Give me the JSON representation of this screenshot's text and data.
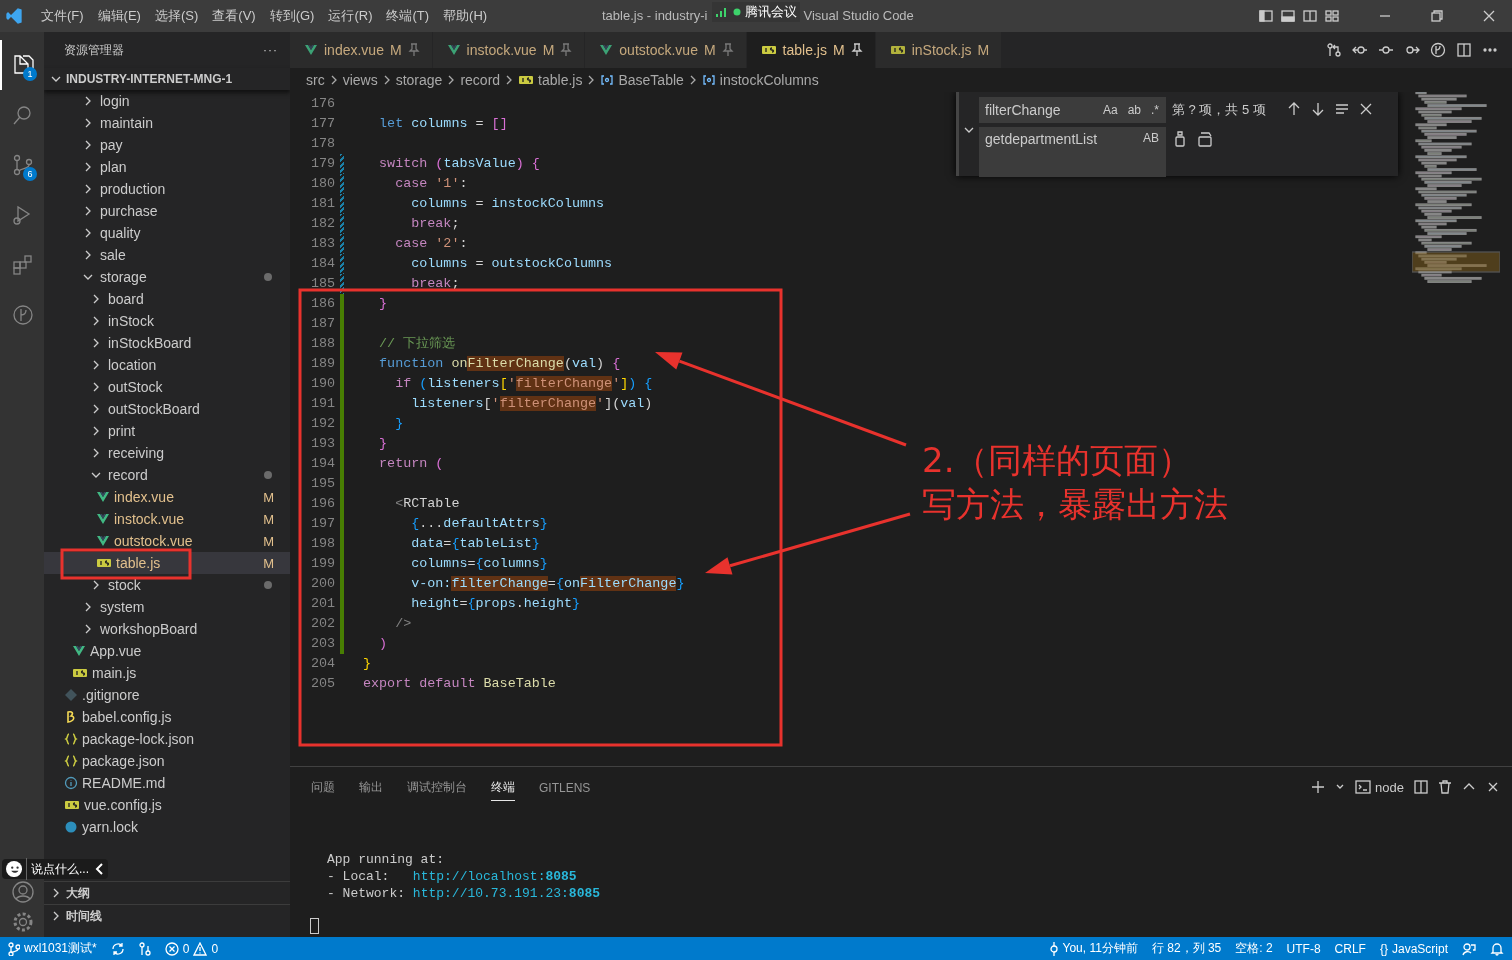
{
  "menu": [
    "文件(F)",
    "编辑(E)",
    "选择(S)",
    "查看(V)",
    "转到(G)",
    "运行(R)",
    "终端(T)",
    "帮助(H)"
  ],
  "title": {
    "file_part": "table.js - industry-i",
    "app_part": "Visual Studio Code"
  },
  "meeting": {
    "label": "腾讯会议"
  },
  "activity_bar": {
    "items": [
      {
        "kind": "files",
        "selected": true,
        "badge": "1"
      },
      {
        "kind": "search",
        "selected": false
      },
      {
        "kind": "scm",
        "selected": false,
        "badge": "6"
      },
      {
        "kind": "debug",
        "selected": false
      },
      {
        "kind": "extensions",
        "selected": false
      },
      {
        "kind": "gitlens",
        "selected": false
      }
    ]
  },
  "sidebar": {
    "title": "资源管理器",
    "more": "···",
    "root": "INDUSTRY-INTERNET-MNG-1",
    "tree": [
      {
        "children": [
          {
            "children": [
              {
                "label": "login",
                "kind": "folder",
                "expanded": false,
                "selected": false
              },
              {
                "label": "maintain",
                "kind": "folder",
                "expanded": false,
                "selected": false
              },
              {
                "label": "pay",
                "kind": "folder",
                "expanded": false,
                "selected": false
              },
              {
                "label": "plan",
                "kind": "folder",
                "expanded": false,
                "selected": false
              },
              {
                "label": "production",
                "kind": "folder",
                "expanded": false,
                "selected": false
              },
              {
                "label": "purchase",
                "kind": "folder",
                "expanded": false,
                "selected": false
              },
              {
                "label": "quality",
                "kind": "folder",
                "expanded": false,
                "selected": false
              },
              {
                "label": "sale",
                "kind": "folder",
                "expanded": false,
                "selected": false
              },
              {
                "label": "storage",
                "kind": "folder",
                "expanded": true,
                "dot": true,
                "selected": false,
                "children": [
                  {
                    "label": "board",
                    "kind": "folder",
                    "expanded": false,
                    "selected": false
                  },
                  {
                    "label": "inStock",
                    "kind": "folder",
                    "expanded": false,
                    "selected": false
                  },
                  {
                    "label": "inStockBoard",
                    "kind": "folder",
                    "expanded": false,
                    "selected": false
                  },
                  {
                    "label": "location",
                    "kind": "folder",
                    "expanded": false,
                    "selected": false
                  },
                  {
                    "label": "outStock",
                    "kind": "folder",
                    "expanded": false,
                    "selected": false
                  },
                  {
                    "label": "outStockBoard",
                    "kind": "folder",
                    "expanded": false,
                    "selected": false
                  },
                  {
                    "label": "print",
                    "kind": "folder",
                    "expanded": false,
                    "selected": false
                  },
                  {
                    "label": "receiving",
                    "kind": "folder",
                    "expanded": false,
                    "selected": false
                  },
                  {
                    "label": "record",
                    "kind": "folder",
                    "expanded": true,
                    "dot": true,
                    "selected": false,
                    "children": [
                      {
                        "label": "index.vue",
                        "kind": "vue",
                        "badge": "M",
                        "selected": false
                      },
                      {
                        "label": "instock.vue",
                        "kind": "vue",
                        "badge": "M",
                        "selected": false
                      },
                      {
                        "label": "outstock.vue",
                        "kind": "vue",
                        "badge": "M",
                        "selected": false
                      },
                      {
                        "label": "table.js",
                        "kind": "js",
                        "badge": "M",
                        "selected": true
                      }
                    ]
                  },
                  {
                    "label": "stock",
                    "kind": "folder",
                    "expanded": false,
                    "dot": true,
                    "selected": false
                  }
                ]
              },
              {
                "label": "system",
                "kind": "folder",
                "expanded": false,
                "selected": false
              },
              {
                "label": "workshopBoard",
                "kind": "folder",
                "expanded": false,
                "selected": false
              }
            ]
          },
          {
            "label": "App.vue",
            "kind": "vue",
            "selected": false
          },
          {
            "label": "main.js",
            "kind": "js",
            "selected": false
          }
        ]
      },
      {
        "label": ".gitignore",
        "kind": "git",
        "selected": false
      },
      {
        "label": "babel.config.js",
        "kind": "babel",
        "selected": false
      },
      {
        "label": "package-lock.json",
        "kind": "json",
        "selected": false
      },
      {
        "label": "package.json",
        "kind": "json",
        "selected": false
      },
      {
        "label": "README.md",
        "kind": "info",
        "selected": false
      },
      {
        "label": "vue.config.js",
        "kind": "js",
        "selected": false
      },
      {
        "label": "yarn.lock",
        "kind": "yarn",
        "selected": false
      }
    ],
    "sections": [
      {
        "label": "大纲",
        "expanded": false
      },
      {
        "label": "时间线",
        "expanded": false
      }
    ]
  },
  "chat_widget": {
    "placeholder": "说点什么..."
  },
  "tabs": [
    {
      "label": "index.vue",
      "kind": "vue",
      "badge": "M",
      "pinned": true,
      "selected": false
    },
    {
      "label": "instock.vue",
      "kind": "vue",
      "badge": "M",
      "pinned": true,
      "selected": false
    },
    {
      "label": "outstock.vue",
      "kind": "vue",
      "badge": "M",
      "pinned": true,
      "selected": false
    },
    {
      "label": "table.js",
      "kind": "js",
      "badge": "M",
      "pinned": true,
      "selected": true
    },
    {
      "label": "inStock.js",
      "kind": "js",
      "badge": "M",
      "pinned": false,
      "selected": false
    }
  ],
  "breadcrumbs": [
    {
      "label": "src",
      "kind": "folder"
    },
    {
      "label": "views",
      "kind": "folder"
    },
    {
      "label": "storage",
      "kind": "folder"
    },
    {
      "label": "record",
      "kind": "folder"
    },
    {
      "label": "table.js",
      "kind": "js"
    },
    {
      "label": "BaseTable",
      "kind": "symbol"
    },
    {
      "label": "instockColumns",
      "kind": "symbol"
    }
  ],
  "find": {
    "value": "filterChange",
    "options": [
      "Aa",
      "ab",
      ".*"
    ],
    "result": "第 ? 项，共 5 项",
    "replace_value": "getdepartmentList",
    "preserve_case": "AB",
    "expanded": true
  },
  "code": {
    "lines": [
      {
        "no": "176",
        "kind": "unchanged"
      },
      {
        "no": "177",
        "kind": "unchanged",
        "segments": [
          {
            "text": "  let",
            "kind": "kw"
          },
          {
            "text": " columns",
            "kind": "var"
          },
          {
            "text": " = "
          },
          {
            "text": "[]",
            "kind": "b2"
          }
        ]
      },
      {
        "no": "178",
        "kind": "unchanged"
      },
      {
        "no": "179",
        "kind": "modified",
        "segments": [
          {
            "text": "  switch",
            "kind": "ctl"
          },
          {
            "text": " (",
            "kind": "b2"
          },
          {
            "text": "tabsValue",
            "kind": "var"
          },
          {
            "text": ")",
            "kind": "b2"
          },
          {
            "text": " {",
            "kind": "b2"
          }
        ]
      },
      {
        "no": "180",
        "kind": "modified",
        "segments": [
          {
            "text": "    case",
            "kind": "ctl"
          },
          {
            "text": " '1'",
            "kind": "str"
          },
          {
            "text": ":"
          }
        ]
      },
      {
        "no": "181",
        "kind": "modified",
        "segments": [
          {
            "text": "      columns",
            "kind": "var"
          },
          {
            "text": " = "
          },
          {
            "text": "instockColumns",
            "kind": "var"
          }
        ]
      },
      {
        "no": "182",
        "kind": "modified",
        "segments": [
          {
            "text": "      break",
            "kind": "ctl"
          },
          {
            "text": ";"
          }
        ]
      },
      {
        "no": "183",
        "kind": "modified",
        "segments": [
          {
            "text": "    case",
            "kind": "ctl"
          },
          {
            "text": " '2'",
            "kind": "str"
          },
          {
            "text": ":"
          }
        ]
      },
      {
        "no": "184",
        "kind": "modified",
        "segments": [
          {
            "text": "      columns",
            "kind": "var"
          },
          {
            "text": " = "
          },
          {
            "text": "outstockColumns",
            "kind": "var"
          }
        ]
      },
      {
        "no": "185",
        "kind": "modified",
        "segments": [
          {
            "text": "      break",
            "kind": "ctl"
          },
          {
            "text": ";"
          }
        ]
      },
      {
        "no": "186",
        "kind": "added",
        "segments": [
          {
            "text": "  }",
            "kind": "b2"
          }
        ]
      },
      {
        "no": "187",
        "kind": "added"
      },
      {
        "no": "188",
        "kind": "added",
        "segments": [
          {
            "text": "  // 下拉筛选",
            "kind": "cm"
          }
        ]
      },
      {
        "no": "189",
        "kind": "added",
        "segments": [
          {
            "text": "  function",
            "kind": "kw"
          },
          {
            "text": " on",
            "kind": "fn"
          },
          {
            "text": "FilterChange",
            "kind": "fn",
            "match": true
          },
          {
            "text": "("
          },
          {
            "text": "val",
            "kind": "var"
          },
          {
            "text": ")"
          },
          {
            "text": " {",
            "kind": "b2"
          }
        ]
      },
      {
        "no": "190",
        "kind": "added",
        "segments": [
          {
            "text": "    if",
            "kind": "ctl"
          },
          {
            "text": " (",
            "kind": "b3"
          },
          {
            "text": "listeners",
            "kind": "var"
          },
          {
            "text": "[",
            "kind": "b1"
          },
          {
            "text": "'",
            "kind": "str"
          },
          {
            "text": "filterChange",
            "kind": "str",
            "match": true
          },
          {
            "text": "'",
            "kind": "str"
          },
          {
            "text": "]",
            "kind": "b1"
          },
          {
            "text": ")",
            "kind": "b3"
          },
          {
            "text": " {",
            "kind": "b3"
          }
        ]
      },
      {
        "no": "191",
        "kind": "added",
        "segments": [
          {
            "text": "      listeners",
            "kind": "var"
          },
          {
            "text": "["
          },
          {
            "text": "'",
            "kind": "str"
          },
          {
            "text": "filterChange",
            "kind": "str",
            "match": true
          },
          {
            "text": "'",
            "kind": "str"
          },
          {
            "text": "]("
          },
          {
            "text": "val",
            "kind": "var"
          },
          {
            "text": ")"
          }
        ]
      },
      {
        "no": "192",
        "kind": "added",
        "segments": [
          {
            "text": "    }",
            "kind": "b3"
          }
        ]
      },
      {
        "no": "193",
        "kind": "added",
        "segments": [
          {
            "text": "  }",
            "kind": "b2"
          }
        ]
      },
      {
        "no": "194",
        "kind": "added",
        "segments": [
          {
            "text": "  return",
            "kind": "ctl"
          },
          {
            "text": " (",
            "kind": "b2"
          }
        ]
      },
      {
        "no": "195",
        "kind": "added"
      },
      {
        "no": "196",
        "kind": "added",
        "segments": [
          {
            "text": "    <",
            "kind": "dim"
          },
          {
            "text": "RCTable"
          }
        ]
      },
      {
        "no": "197",
        "kind": "added",
        "segments": [
          {
            "text": "      {",
            "kind": "b3"
          },
          {
            "text": "..."
          },
          {
            "text": "defaultAttrs",
            "kind": "var"
          },
          {
            "text": "}",
            "kind": "b3"
          }
        ]
      },
      {
        "no": "198",
        "kind": "added",
        "segments": [
          {
            "text": "      data",
            "kind": "var"
          },
          {
            "text": "="
          },
          {
            "text": "{",
            "kind": "b3"
          },
          {
            "text": "tableList",
            "kind": "var"
          },
          {
            "text": "}",
            "kind": "b3"
          }
        ]
      },
      {
        "no": "199",
        "kind": "added",
        "segments": [
          {
            "text": "      columns",
            "kind": "var"
          },
          {
            "text": "="
          },
          {
            "text": "{",
            "kind": "b3"
          },
          {
            "text": "columns",
            "kind": "var"
          },
          {
            "text": "}",
            "kind": "b3"
          }
        ]
      },
      {
        "no": "200",
        "kind": "added",
        "segments": [
          {
            "text": "      v-on:",
            "kind": "var"
          },
          {
            "text": "filterChange",
            "kind": "var",
            "match": true
          },
          {
            "text": "="
          },
          {
            "text": "{",
            "kind": "b3"
          },
          {
            "text": "on",
            "kind": "var"
          },
          {
            "text": "FilterChange",
            "kind": "var",
            "match": true
          },
          {
            "text": "}",
            "kind": "b3"
          }
        ]
      },
      {
        "no": "201",
        "kind": "added",
        "segments": [
          {
            "text": "      height",
            "kind": "var"
          },
          {
            "text": "="
          },
          {
            "text": "{",
            "kind": "b3"
          },
          {
            "text": "props",
            "kind": "var"
          },
          {
            "text": "."
          },
          {
            "text": "height",
            "kind": "var"
          },
          {
            "text": "}",
            "kind": "b3"
          }
        ]
      },
      {
        "no": "202",
        "kind": "added",
        "segments": [
          {
            "text": "    />",
            "kind": "dim"
          }
        ]
      },
      {
        "no": "203",
        "kind": "added",
        "segments": [
          {
            "text": "  )",
            "kind": "b2"
          }
        ]
      },
      {
        "no": "204",
        "kind": "unchanged",
        "segments": [
          {
            "text": "}",
            "kind": "b1"
          }
        ]
      },
      {
        "no": "205",
        "kind": "unchanged",
        "segments": [
          {
            "text": "export",
            "kind": "ctl"
          },
          {
            "text": " default",
            "kind": "ctl"
          },
          {
            "text": " BaseTable",
            "kind": "fn"
          }
        ]
      }
    ]
  },
  "annotation": {
    "lines": [
      "2.（同样的页面）",
      "写方法，暴露出方法"
    ]
  },
  "panel": {
    "tabs": [
      {
        "label": "问题",
        "selected": false
      },
      {
        "label": "输出",
        "selected": false
      },
      {
        "label": "调试控制台",
        "selected": false
      },
      {
        "label": "终端",
        "selected": true
      },
      {
        "label": "GITLENS",
        "selected": false
      }
    ],
    "shell": "node",
    "terminal": [
      {
        "parts": [
          {
            "text": "App running at:"
          }
        ]
      },
      {
        "parts": [
          {
            "text": "- Local:   "
          },
          {
            "text": "http://localhost:",
            "kind": "link"
          },
          {
            "text": "8085",
            "kind": "linkb"
          }
        ]
      },
      {
        "parts": [
          {
            "text": "- Network: "
          },
          {
            "text": "http://10.73.191.23:",
            "kind": "link"
          },
          {
            "text": "8085",
            "kind": "linkb"
          }
        ]
      }
    ]
  },
  "status_bar": {
    "branch": "wxl1031测试*",
    "errors": "0",
    "warnings": "0",
    "blame": "You, 11分钟前",
    "position": "行 82，列 35",
    "indent": "空格: 2",
    "encoding": "UTF-8",
    "eol": "CRLF",
    "language_icon": "{}",
    "language": "JavaScript"
  }
}
